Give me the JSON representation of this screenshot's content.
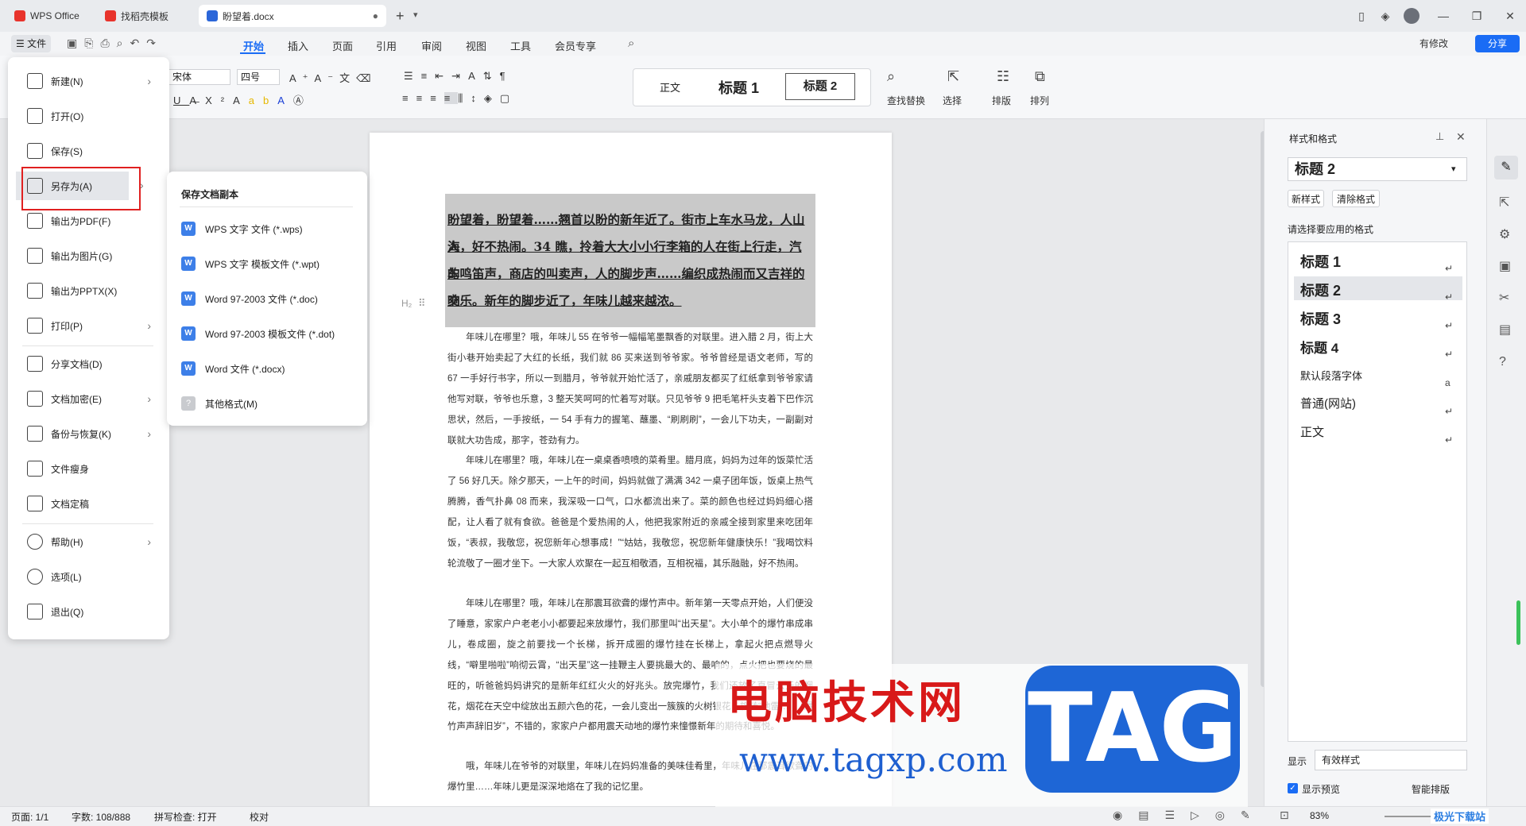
{
  "titlebar": {
    "tabs": [
      {
        "label": "WPS Office"
      },
      {
        "label": "找稻壳模板"
      },
      {
        "label": "盼望着.docx"
      }
    ],
    "new_tab": "+"
  },
  "menubar": {
    "file_label": "文件",
    "tabs": [
      "开始",
      "插入",
      "页面",
      "引用",
      "审阅",
      "视图",
      "工具",
      "会员专享"
    ],
    "active_tab": "开始",
    "has_changes": "有修改",
    "share": "分享"
  },
  "toolbar": {
    "font_name": "宋体",
    "font_size": "四号",
    "styles": [
      "正文",
      "标题 1",
      "标题 2"
    ],
    "find_replace": "查找替换",
    "select": "选择",
    "layout": "排版",
    "arrange": "排列"
  },
  "document": {
    "heading_lines": [
      "盼望着，盼望着……翘首以盼的新年近了。街市上车水马龙，人山人",
      "海，好不热闹。34 瞧，拎着大大小小行李箱的人在街上行走，汽车",
      "的鸣笛声，商店的叫卖声，人的脚步声……编织成热闹而又吉祥的交",
      "响乐。新年的脚步近了，年味儿越来越浓。"
    ],
    "paragraphs": [
      "　　年味儿在哪里？哦，年味儿 55 在爷爷一幅幅笔墨飘香的对联里。进入腊 2 月，街上大街小巷开始卖起了大红的长纸，我们就 86 买来送到爷爷家。爷爷曾经是语文老师，写的 67 一手好行书字，所以一到腊月，爷爷就开始忙活了，亲戚朋友都买了红纸拿到爷爷家请他写对联，爷爷也乐意，3 整天笑呵呵的忙着写对联。只见爷爷 9 把毛笔杆头支着下巴作沉思状，然后，一手按纸，一 54 手有力的握笔、蘸墨、“刷刷刷”，一会儿下功夫，一副副对联就大功告成，那字，苍劲有力。",
      "　　年味儿在哪里？哦，年味儿在一桌桌香喷喷的菜肴里。腊月底，妈妈为过年的饭菜忙活了 56 好几天。除夕那天，一上午的时间，妈妈就做了满满 342 一桌子团年饭，饭桌上热气腾腾，香气扑鼻 08 而来，我深吸一口气，口水都流出来了。菜的颜色也经过妈妈细心搭配，让人看了就有食欲。爸爸是个爱热闹的人，他把我家附近的亲戚全接到家里来吃团年饭，“表叔，我敬您，祝您新年心想事成！”“姑姑，我敬您，祝您新年健康快乐！”我喝饮料轮流敬了一圈才坐下。一大家人欢聚在一起互相敬酒，互相祝福，其乐融融，好不热闹。",
      "　　年味儿在哪里？哦，年味儿在那震耳欲聋的爆竹声中。新年第一天零点开始，人们便没了睡意，家家户户老老小小都要起来放爆竹，我们那里叫“出天星”。大小单个的爆竹串成串儿，卷成圈，旋之前要找一个长梯，拆开成圈的爆竹挂在长梯上，拿起火把点燃导火线，“噼里啪啦”响彻云霄，“出天星”这一挂鞭主人要挑最大的、最响的，点火把也要烧的最旺的，听爸爸妈妈讲究的是新年红红火火的好兆头。放完爆竹，我们还放了直冒云天的烟花，烟花在天空中绽放出五颜六色的花，一会儿变出一簇簇的火树银花，旋转“地雷”……“爆竹声声辞旧岁”，不错的，家家户户都用震天动地的爆竹来憧憬新年的期待和喜悦。",
      "　　哦，年味儿在爷爷的对联里，年味儿在妈妈准备的美味佳肴里，年味儿在那震耳欲聋的爆竹里……年味儿更是深深地烙在了我的记忆里。"
    ],
    "heading_marker": "H₂"
  },
  "file_menu": {
    "items": [
      {
        "label": "新建(N)",
        "arrow": true
      },
      {
        "label": "打开(O)",
        "arrow": false
      },
      {
        "label": "保存(S)",
        "arrow": false
      },
      {
        "label": "另存为(A)",
        "arrow": true
      },
      {
        "label": "输出为PDF(F)",
        "arrow": false
      },
      {
        "label": "输出为图片(G)",
        "arrow": false
      },
      {
        "label": "输出为PPTX(X)",
        "arrow": false
      },
      {
        "label": "打印(P)",
        "arrow": true
      },
      {
        "label": "分享文档(D)",
        "arrow": false
      },
      {
        "label": "文档加密(E)",
        "arrow": true
      },
      {
        "label": "备份与恢复(K)",
        "arrow": true
      },
      {
        "label": "文件瘦身",
        "arrow": false
      },
      {
        "label": "文档定稿",
        "arrow": false
      },
      {
        "label": "帮助(H)",
        "arrow": true
      },
      {
        "label": "选项(L)",
        "arrow": false
      },
      {
        "label": "退出(Q)",
        "arrow": false
      }
    ],
    "selected": "另存为(A)"
  },
  "save_as_submenu": {
    "title": "保存文档副本",
    "items": [
      "WPS 文字 文件 (*.wps)",
      "WPS 文字 模板文件 (*.wpt)",
      "Word 97-2003 文件 (*.doc)",
      "Word 97-2003 模板文件 (*.dot)",
      "Word 文件 (*.docx)",
      "其他格式(M)"
    ]
  },
  "style_panel": {
    "title": "样式和格式",
    "current_style": "标题 2",
    "new_style": "新样式",
    "clear_format": "清除格式",
    "prompt": "请选择要应用的格式",
    "styles": [
      "标题 1",
      "标题 2",
      "标题 3",
      "标题 4",
      "默认段落字体",
      "普通(网站)",
      "正文"
    ],
    "selected_style": "标题 2",
    "show_label": "显示",
    "show_value": "有效样式",
    "preview_label": "显示预览",
    "smart_layout": "智能排版"
  },
  "statusbar": {
    "page": "页面: 1/1",
    "words": "字数: 108/888",
    "spellcheck": "拼写检查: 打开",
    "proofread": "校对",
    "zoom": "83%"
  },
  "watermark": {
    "title": "电脑技术网",
    "url": "www.tagxp.com",
    "logo": "TAG",
    "corner": "极光下载站"
  },
  "colors": {
    "accent": "#1a6cf5",
    "highlight_box": "#e02020",
    "watermark_red": "#d81919",
    "watermark_blue": "#1e66d6"
  }
}
